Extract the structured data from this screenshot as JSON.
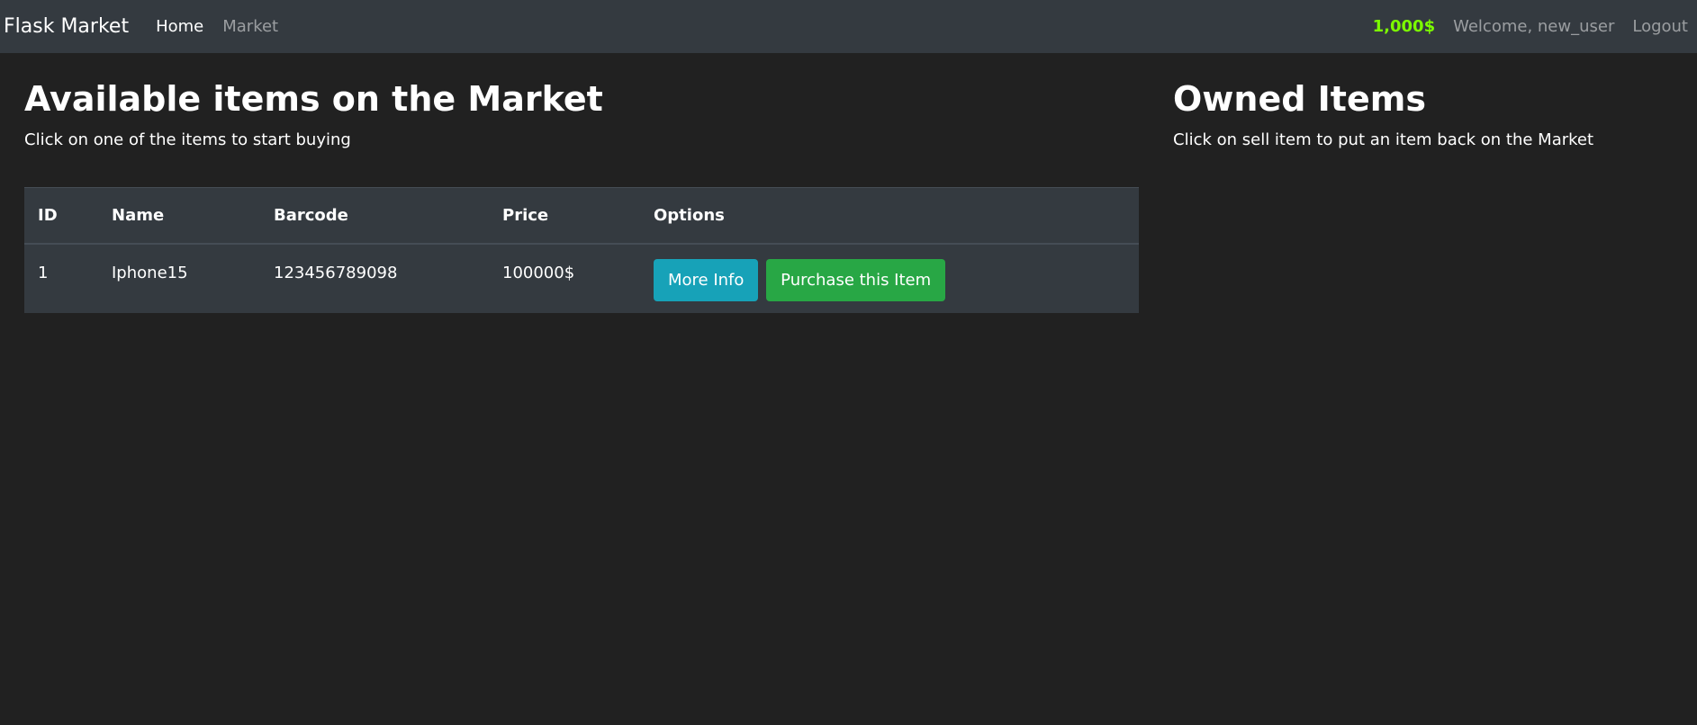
{
  "navbar": {
    "brand": "Flask Market",
    "links": [
      {
        "label": "Home"
      },
      {
        "label": "Market"
      }
    ],
    "budget": "1,000$",
    "welcome": "Welcome, new_user",
    "logout": "Logout"
  },
  "market": {
    "title": "Available items on the Market",
    "subtitle": "Click on one of the items to start buying",
    "columns": [
      "ID",
      "Name",
      "Barcode",
      "Price",
      "Options"
    ],
    "rows": [
      {
        "id": "1",
        "name": "Iphone15",
        "barcode": "123456789098",
        "price": "100000$",
        "more_info_label": "More Info",
        "purchase_label": "Purchase this Item"
      }
    ]
  },
  "owned": {
    "title": "Owned Items",
    "subtitle": "Click on sell item to put an item back on the Market"
  },
  "colors": {
    "navbar_bg": "#343a40",
    "page_bg": "#212121",
    "budget": "#7CFC00",
    "info": "#17a2b8",
    "success": "#28a745"
  }
}
